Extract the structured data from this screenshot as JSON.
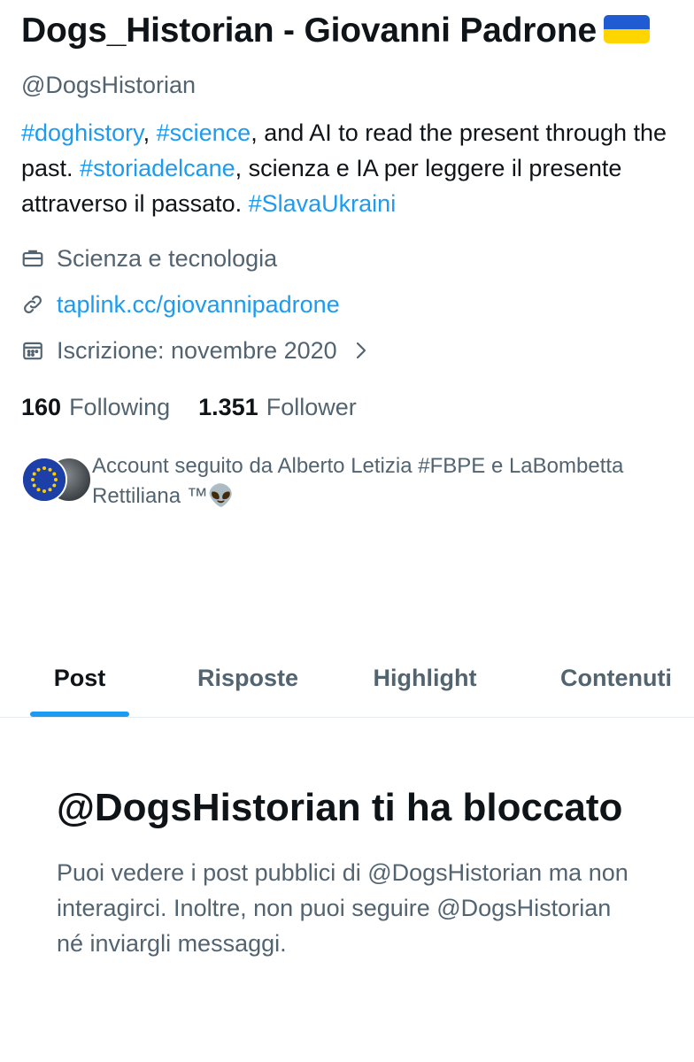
{
  "profile": {
    "display_name": "Dogs_Historian - Giovanni Padrone",
    "flag_icon": "ukraine-flag-emoji",
    "handle": "@DogsHistorian",
    "bio": {
      "tag1": "#doghistory",
      "sep1": ", ",
      "tag2": "#science",
      "text1": ", and AI to read the present through the past. ",
      "tag3": "#storiadelcane",
      "text2": ", scienza e IA per leggere il presente attraverso il passato. ",
      "tag4": "#SlavaUkraini"
    },
    "category": "Scienza e tecnologia",
    "website": "taplink.cc/giovannipadrone",
    "joined": "Iscrizione: novembre 2020",
    "following_count": "160",
    "following_label": "Following",
    "followers_count": "1.351",
    "followers_label": "Follower",
    "followed_by": "Account seguito da Alberto Letizia #FBPE e LaBombetta Rettiliana ™👽"
  },
  "icons": {
    "category": "briefcase-icon",
    "website": "link-icon",
    "joined": "calendar-icon",
    "chevron": "chevron-right-icon"
  },
  "tabs": [
    {
      "label": "Post",
      "active": true
    },
    {
      "label": "Risposte",
      "active": false
    },
    {
      "label": "Highlight",
      "active": false
    },
    {
      "label": "Contenuti",
      "active": false
    }
  ],
  "blocked": {
    "title": "@DogsHistorian ti ha bloccato",
    "description": "Puoi vedere i post pubblici di @DogsHistorian ma non interagirci. Inoltre, non puoi seguire @DogsHistorian né inviargli messaggi."
  },
  "colors": {
    "accent": "#1d9bf0",
    "text": "#0f1419",
    "secondary": "#536471"
  }
}
